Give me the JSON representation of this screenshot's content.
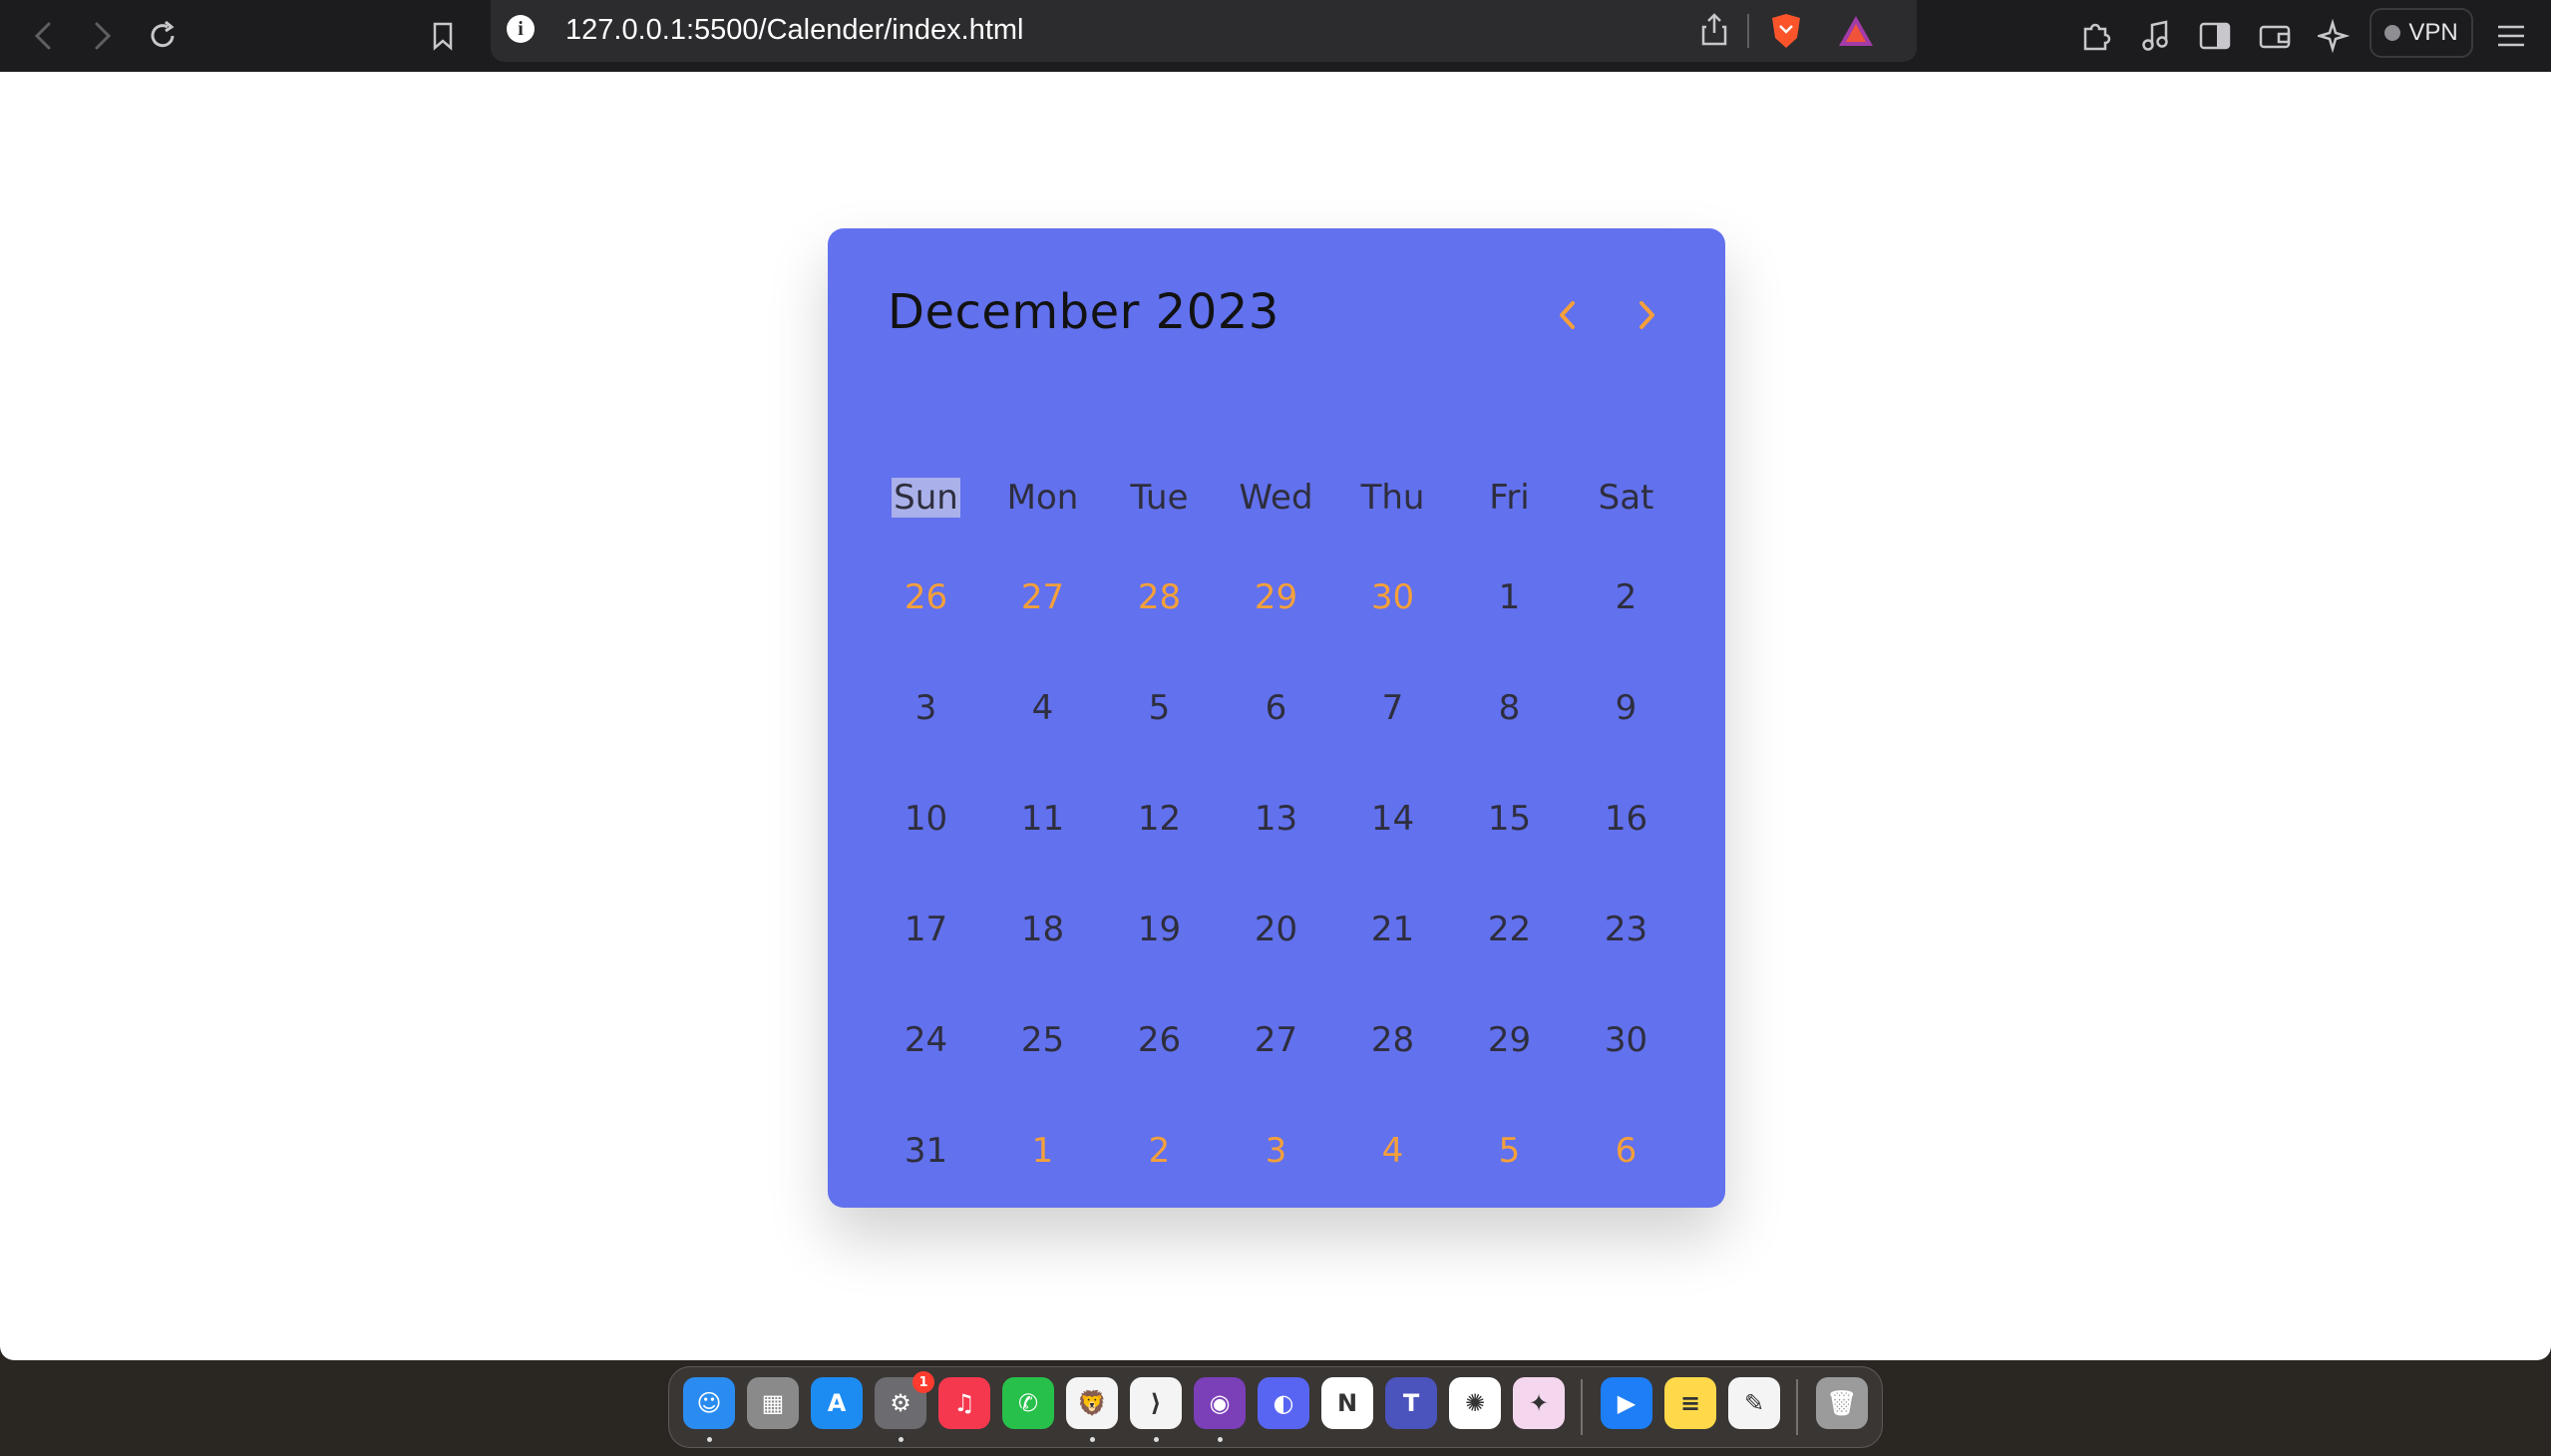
{
  "browser": {
    "url": "127.0.0.1:5500/Calender/index.html",
    "vpn_label": "VPN"
  },
  "calendar": {
    "title": "December 2023",
    "weekdays": [
      "Sun",
      "Mon",
      "Tue",
      "Wed",
      "Thu",
      "Fri",
      "Sat"
    ],
    "weeks": [
      [
        {
          "d": "26",
          "other": true
        },
        {
          "d": "27",
          "other": true
        },
        {
          "d": "28",
          "other": true
        },
        {
          "d": "29",
          "other": true
        },
        {
          "d": "30",
          "other": true
        },
        {
          "d": "1",
          "other": false
        },
        {
          "d": "2",
          "other": false
        }
      ],
      [
        {
          "d": "3",
          "other": false
        },
        {
          "d": "4",
          "other": false
        },
        {
          "d": "5",
          "other": false
        },
        {
          "d": "6",
          "other": false
        },
        {
          "d": "7",
          "other": false
        },
        {
          "d": "8",
          "other": false
        },
        {
          "d": "9",
          "other": false
        }
      ],
      [
        {
          "d": "10",
          "other": false
        },
        {
          "d": "11",
          "other": false
        },
        {
          "d": "12",
          "other": false
        },
        {
          "d": "13",
          "other": false
        },
        {
          "d": "14",
          "other": false
        },
        {
          "d": "15",
          "other": false
        },
        {
          "d": "16",
          "other": false
        }
      ],
      [
        {
          "d": "17",
          "other": false
        },
        {
          "d": "18",
          "other": false
        },
        {
          "d": "19",
          "other": false
        },
        {
          "d": "20",
          "other": false
        },
        {
          "d": "21",
          "other": false
        },
        {
          "d": "22",
          "other": false
        },
        {
          "d": "23",
          "other": false
        }
      ],
      [
        {
          "d": "24",
          "other": false
        },
        {
          "d": "25",
          "other": false
        },
        {
          "d": "26",
          "other": false
        },
        {
          "d": "27",
          "other": false
        },
        {
          "d": "28",
          "other": false
        },
        {
          "d": "29",
          "other": false
        },
        {
          "d": "30",
          "other": false
        }
      ],
      [
        {
          "d": "31",
          "other": false
        },
        {
          "d": "1",
          "other": true
        },
        {
          "d": "2",
          "other": true
        },
        {
          "d": "3",
          "other": true
        },
        {
          "d": "4",
          "other": true
        },
        {
          "d": "5",
          "other": true
        },
        {
          "d": "6",
          "other": true
        }
      ]
    ],
    "colors": {
      "background": "#6271ed",
      "accent": "#f5a03a",
      "text": "#2e2e3e"
    }
  },
  "dock": {
    "apps": [
      {
        "name": "finder-icon",
        "color": "#2a8cf0",
        "glyph": "☺",
        "running": true
      },
      {
        "name": "launchpad-icon",
        "color": "#8a8a8a",
        "glyph": "▦",
        "running": false
      },
      {
        "name": "app-store-icon",
        "color": "#1d8cf2",
        "glyph": "A",
        "running": false
      },
      {
        "name": "system-settings-icon",
        "color": "#6c6c70",
        "glyph": "⚙",
        "running": true,
        "badge": "1"
      },
      {
        "name": "music-icon",
        "color": "#f5384e",
        "glyph": "♫",
        "running": false
      },
      {
        "name": "whatsapp-icon",
        "color": "#27c04a",
        "glyph": "✆",
        "running": false
      },
      {
        "name": "brave-icon",
        "color": "#f4f4f4",
        "glyph": "🦁",
        "running": true
      },
      {
        "name": "vscode-icon",
        "color": "#f4f4f4",
        "glyph": "⟩",
        "running": true
      },
      {
        "name": "github-desktop-icon",
        "color": "#7b3fb8",
        "glyph": "◉",
        "running": true
      },
      {
        "name": "discord-icon",
        "color": "#5865f2",
        "glyph": "◐",
        "running": false
      },
      {
        "name": "notion-icon",
        "color": "#ffffff",
        "glyph": "N",
        "running": false
      },
      {
        "name": "teams-icon",
        "color": "#4b53bc",
        "glyph": "T",
        "running": false
      },
      {
        "name": "chatgpt-icon",
        "color": "#ffffff",
        "glyph": "✺",
        "running": false
      },
      {
        "name": "sketch-icon",
        "color": "#f4d7ee",
        "glyph": "✦",
        "running": false
      }
    ],
    "apps2": [
      {
        "name": "prime-video-icon",
        "color": "#1d7ef7",
        "glyph": "▶",
        "running": false
      },
      {
        "name": "notes-icon",
        "color": "#ffd94a",
        "glyph": "≡",
        "running": false
      },
      {
        "name": "textedit-icon",
        "color": "#f4f4f4",
        "glyph": "✎",
        "running": false
      }
    ],
    "trash": {
      "name": "trash-icon",
      "color": "#9b9b9b",
      "glyph": "🗑"
    }
  }
}
